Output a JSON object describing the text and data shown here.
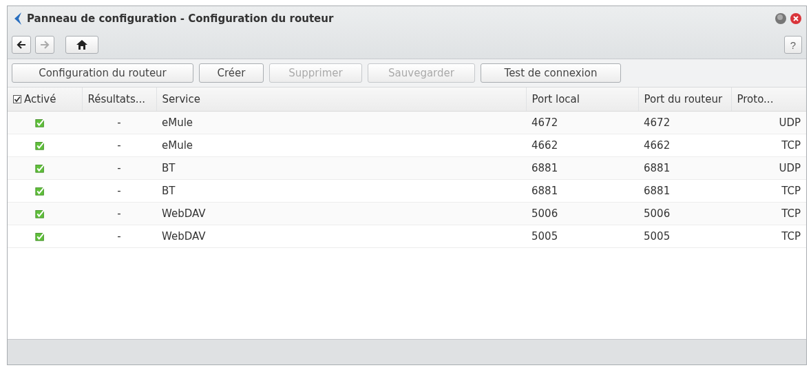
{
  "window": {
    "title": "Panneau de configuration - Configuration du routeur"
  },
  "nav": {
    "back_disabled": false,
    "forward_disabled": true,
    "help": "?"
  },
  "toolbar": [
    {
      "label": "Configuration du routeur",
      "disabled": false
    },
    {
      "label": "Créer",
      "disabled": false
    },
    {
      "label": "Supprimer",
      "disabled": true
    },
    {
      "label": "Sauvegarder",
      "disabled": true
    },
    {
      "label": "Test de connexion",
      "disabled": false
    }
  ],
  "table": {
    "header_checked": true,
    "columns": [
      "Activé",
      "Résultats...",
      "Service",
      "Port local",
      "Port du routeur",
      "Proto..."
    ],
    "rows": [
      {
        "enabled": true,
        "result": "-",
        "service": "eMule",
        "local_port": "4672",
        "router_port": "4672",
        "protocol": "UDP"
      },
      {
        "enabled": true,
        "result": "-",
        "service": "eMule",
        "local_port": "4662",
        "router_port": "4662",
        "protocol": "TCP"
      },
      {
        "enabled": true,
        "result": "-",
        "service": "BT",
        "local_port": "6881",
        "router_port": "6881",
        "protocol": "UDP"
      },
      {
        "enabled": true,
        "result": "-",
        "service": "BT",
        "local_port": "6881",
        "router_port": "6881",
        "protocol": "TCP"
      },
      {
        "enabled": true,
        "result": "-",
        "service": "WebDAV",
        "local_port": "5006",
        "router_port": "5006",
        "protocol": "TCP"
      },
      {
        "enabled": true,
        "result": "-",
        "service": "WebDAV",
        "local_port": "5005",
        "router_port": "5005",
        "protocol": "TCP"
      }
    ]
  }
}
